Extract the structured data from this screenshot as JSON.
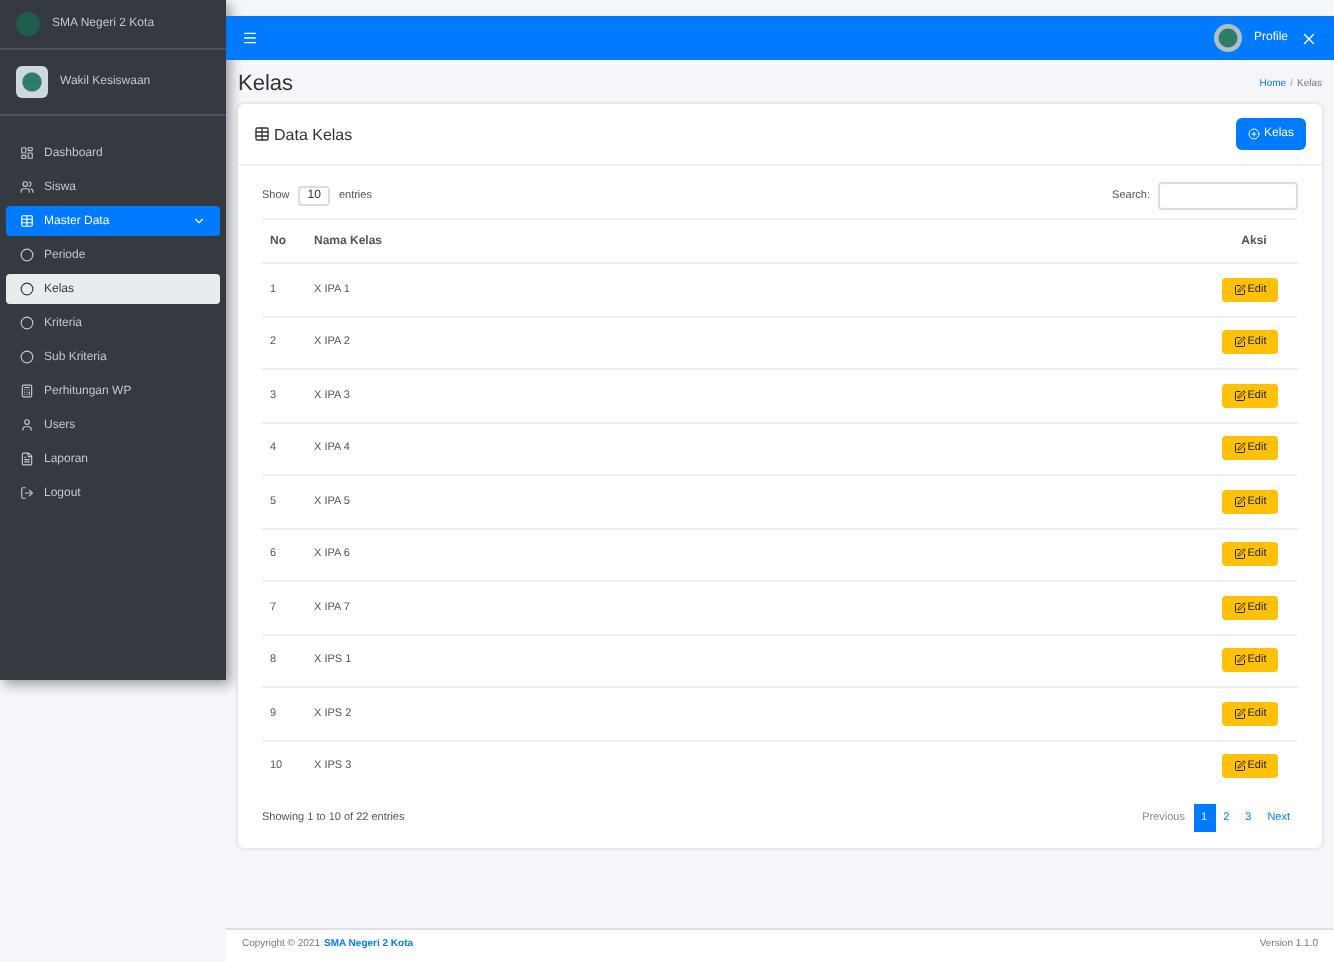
{
  "brand": "SMA Negeri 2 Kota",
  "user_panel": {
    "name": "Wakil Kesiswaan"
  },
  "sidebar": {
    "items": [
      {
        "label": "Dashboard",
        "selected": false
      },
      {
        "label": "Siswa",
        "selected": false
      },
      {
        "label": "Master Data",
        "selected": true,
        "expanded": true,
        "children": [
          {
            "label": "Periode",
            "selected": false
          },
          {
            "label": "Kelas",
            "selected": true
          },
          {
            "label": "Kriteria",
            "selected": false
          },
          {
            "label": "Sub Kriteria",
            "selected": false
          }
        ]
      },
      {
        "label": "Perhitungan WP",
        "selected": false
      },
      {
        "label": "Users",
        "selected": false
      },
      {
        "label": "Laporan",
        "selected": false
      },
      {
        "label": "Logout",
        "selected": false
      }
    ]
  },
  "navbar": {
    "user": "Profile"
  },
  "page": {
    "title": "Kelas",
    "breadcrumb": [
      "Home",
      "Kelas"
    ],
    "breadcrumb_separator": "/"
  },
  "card": {
    "title": "Data Kelas",
    "add_button": "Kelas"
  },
  "table_controls": {
    "show_label": "Show",
    "length": "10",
    "entries_label": "entries",
    "search_label": "Search:"
  },
  "table": {
    "columns": [
      "No",
      "Nama Kelas",
      "Aksi"
    ],
    "rows": [
      {
        "no": "1",
        "name": "X IPA 1",
        "action": "Edit"
      },
      {
        "no": "2",
        "name": "X IPA 2",
        "action": "Edit"
      },
      {
        "no": "3",
        "name": "X IPA 3",
        "action": "Edit"
      },
      {
        "no": "4",
        "name": "X IPA 4",
        "action": "Edit"
      },
      {
        "no": "5",
        "name": "X IPA 5",
        "action": "Edit"
      },
      {
        "no": "6",
        "name": "X IPA 6",
        "action": "Edit"
      },
      {
        "no": "7",
        "name": "X IPA 7",
        "action": "Edit"
      },
      {
        "no": "8",
        "name": "X IPS 1",
        "action": "Edit"
      },
      {
        "no": "9",
        "name": "X IPS 2",
        "action": "Edit"
      },
      {
        "no": "10",
        "name": "X IPS 3",
        "action": "Edit"
      }
    ]
  },
  "info": "Showing 1 to 10 of 22 entries",
  "pagination": [
    {
      "label": "Previous",
      "selected": false
    },
    {
      "label": "1",
      "selected": true
    },
    {
      "label": "2",
      "selected": false
    },
    {
      "label": "3",
      "selected": false
    },
    {
      "label": "Next",
      "selected": false
    }
  ],
  "footer": {
    "copyright": "Copyright © 2021",
    "link": "SMA Negeri 2 Kota",
    "version": "Version 1.1.0"
  }
}
